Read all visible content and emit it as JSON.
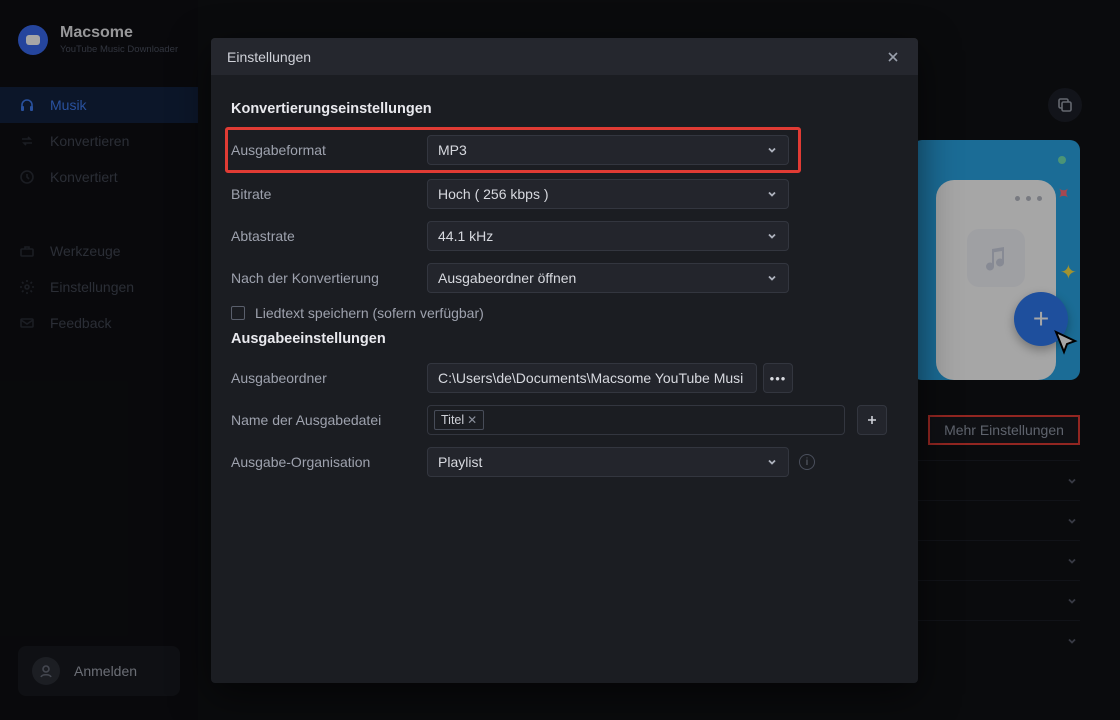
{
  "brand": {
    "name": "Macsome",
    "sub": "YouTube Music Downloader"
  },
  "sidebar": {
    "items": [
      {
        "label": "Musik",
        "active": true
      },
      {
        "label": "Konvertieren",
        "active": false
      },
      {
        "label": "Konvertiert",
        "active": false
      }
    ],
    "utilities": [
      {
        "label": "Werkzeuge"
      },
      {
        "label": "Einstellungen"
      },
      {
        "label": "Feedback"
      }
    ],
    "signin_label": "Anmelden"
  },
  "main": {
    "more_settings_label": "Mehr Einstellungen"
  },
  "modal": {
    "title": "Einstellungen",
    "section_conversion": "Konvertierungseinstellungen",
    "section_output": "Ausgabeeinstellungen",
    "fields": {
      "output_format": {
        "label": "Ausgabeformat",
        "value": "MP3"
      },
      "bitrate": {
        "label": "Bitrate",
        "value": "Hoch ( 256 kbps )"
      },
      "sample_rate": {
        "label": "Abtastrate",
        "value": "44.1 kHz"
      },
      "after_convert": {
        "label": "Nach der Konvertierung",
        "value": "Ausgabeordner öffnen"
      },
      "save_lyrics": {
        "label": "Liedtext speichern (sofern verfügbar)",
        "checked": false
      },
      "output_folder": {
        "label": "Ausgabeordner",
        "value": "C:\\Users\\de\\Documents\\Macsome YouTube Musi"
      },
      "file_name": {
        "label": "Name der Ausgabedatei",
        "tag": "Titel"
      },
      "organization": {
        "label": "Ausgabe-Organisation",
        "value": "Playlist"
      }
    }
  }
}
